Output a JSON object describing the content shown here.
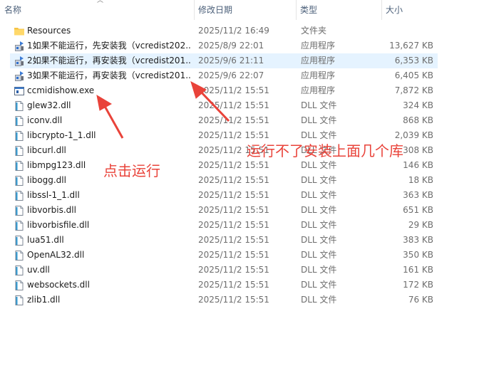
{
  "columns": {
    "name": "名称",
    "date": "修改日期",
    "type": "类型",
    "size": "大小"
  },
  "files": [
    {
      "name": "Resources",
      "date": "2025/11/2 16:49",
      "type": "文件夹",
      "size": "",
      "icon": "folder-icon"
    },
    {
      "name": "1如果不能运行，先安装我（vcredist202...",
      "date": "2025/8/9 22:01",
      "type": "应用程序",
      "size": "13,627 KB",
      "icon": "installer-icon"
    },
    {
      "name": "2如果不能运行，再安装我（vcredist201...",
      "date": "2025/9/6 21:11",
      "type": "应用程序",
      "size": "6,353 KB",
      "icon": "installer-icon"
    },
    {
      "name": "3如果不能运行，再安装我（vcredist201...",
      "date": "2025/9/6 22:07",
      "type": "应用程序",
      "size": "6,405 KB",
      "icon": "installer-icon"
    },
    {
      "name": "ccmidishow.exe",
      "date": "2025/11/2 15:51",
      "type": "应用程序",
      "size": "7,872 KB",
      "icon": "exe-icon"
    },
    {
      "name": "glew32.dll",
      "date": "2025/11/2 15:51",
      "type": "DLL 文件",
      "size": "324 KB",
      "icon": "dll-icon"
    },
    {
      "name": "iconv.dll",
      "date": "2025/11/2 15:51",
      "type": "DLL 文件",
      "size": "868 KB",
      "icon": "dll-icon"
    },
    {
      "name": "libcrypto-1_1.dll",
      "date": "2025/11/2 15:51",
      "type": "DLL 文件",
      "size": "2,039 KB",
      "icon": "dll-icon"
    },
    {
      "name": "libcurl.dll",
      "date": "2025/11/2 15:51",
      "type": "DLL 文件",
      "size": "308 KB",
      "icon": "dll-icon"
    },
    {
      "name": "libmpg123.dll",
      "date": "2025/11/2 15:51",
      "type": "DLL 文件",
      "size": "146 KB",
      "icon": "dll-icon"
    },
    {
      "name": "libogg.dll",
      "date": "2025/11/2 15:51",
      "type": "DLL 文件",
      "size": "18 KB",
      "icon": "dll-icon"
    },
    {
      "name": "libssl-1_1.dll",
      "date": "2025/11/2 15:51",
      "type": "DLL 文件",
      "size": "363 KB",
      "icon": "dll-icon"
    },
    {
      "name": "libvorbis.dll",
      "date": "2025/11/2 15:51",
      "type": "DLL 文件",
      "size": "651 KB",
      "icon": "dll-icon"
    },
    {
      "name": "libvorbisfile.dll",
      "date": "2025/11/2 15:51",
      "type": "DLL 文件",
      "size": "29 KB",
      "icon": "dll-icon"
    },
    {
      "name": "lua51.dll",
      "date": "2025/11/2 15:51",
      "type": "DLL 文件",
      "size": "383 KB",
      "icon": "dll-icon"
    },
    {
      "name": "OpenAL32.dll",
      "date": "2025/11/2 15:51",
      "type": "DLL 文件",
      "size": "350 KB",
      "icon": "dll-icon"
    },
    {
      "name": "uv.dll",
      "date": "2025/11/2 15:51",
      "type": "DLL 文件",
      "size": "161 KB",
      "icon": "dll-icon"
    },
    {
      "name": "websockets.dll",
      "date": "2025/11/2 15:51",
      "type": "DLL 文件",
      "size": "172 KB",
      "icon": "dll-icon"
    },
    {
      "name": "zlib1.dll",
      "date": "2025/11/2 15:51",
      "type": "DLL 文件",
      "size": "76 KB",
      "icon": "dll-icon"
    }
  ],
  "selected_row": 2,
  "annotations": {
    "click_run": "点击运行",
    "install_above": "运行不了安装上面几个库"
  },
  "colors": {
    "annotation": "#e9433a",
    "selection": "#e5f3ff",
    "header_text": "#4c607a"
  }
}
